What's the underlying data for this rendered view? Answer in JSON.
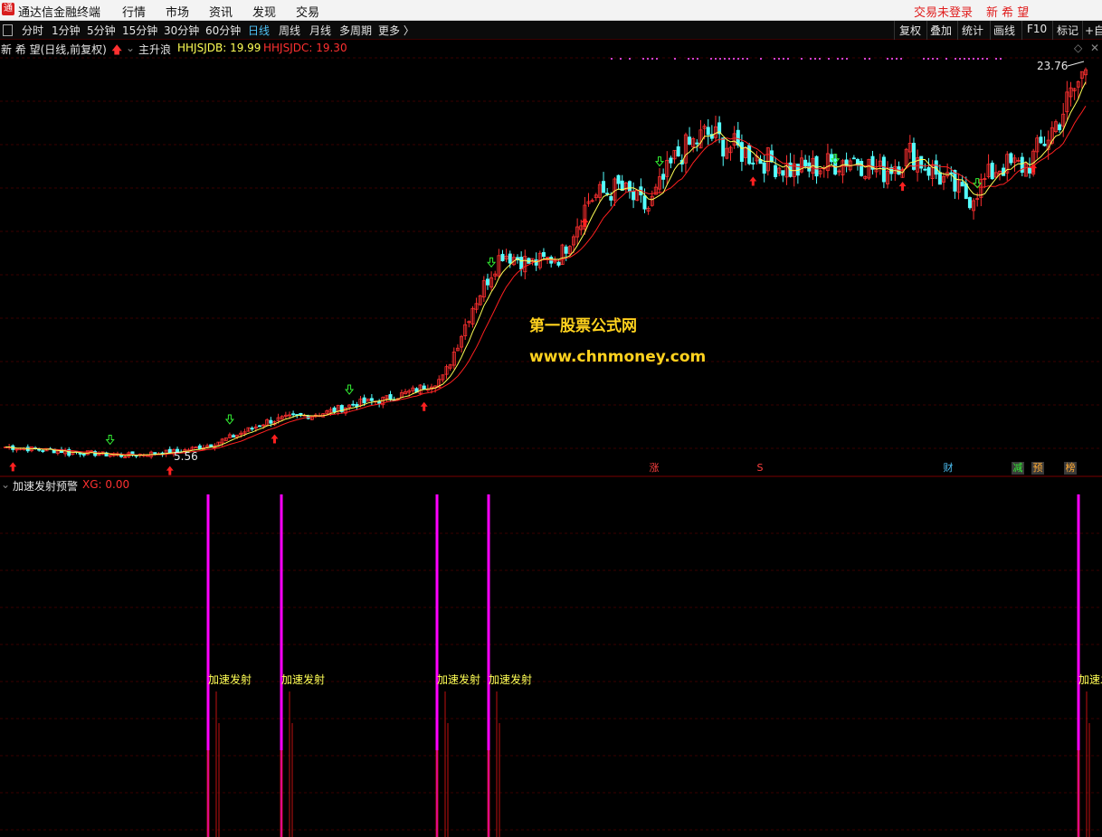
{
  "app": {
    "title": "通达信金融终端"
  },
  "menu": [
    "行情",
    "市场",
    "资讯",
    "发现",
    "交易"
  ],
  "status": {
    "login": "交易未登录",
    "stock_name": "新 希 望"
  },
  "periods": [
    "分时",
    "1分钟",
    "5分钟",
    "15分钟",
    "30分钟",
    "60分钟",
    "日线",
    "周线",
    "月线",
    "多周期",
    "更多 〉"
  ],
  "active_period": "日线",
  "right_tools": [
    "复权",
    "叠加",
    "统计",
    "画线",
    "F10",
    "标记",
    "+自"
  ],
  "main_chart": {
    "stock_label": "新 希 望(日线,前复权)",
    "indicator_name": "主升浪",
    "line1_label": "HHJSJDB: 19.99",
    "line2_label": "HHJSJDC: 19.30",
    "high_label": "23.76",
    "low_label": "5.56",
    "watermark_cn": "第一股票公式网",
    "watermark_url": "www.chnmoney.com",
    "event_markers": [
      "涨",
      "S",
      "财",
      "减",
      "预",
      "榜"
    ],
    "colors": {
      "up": "#ff3030",
      "down": "#54ffff",
      "ma_fast": "#ffff55",
      "ma_slow": "#ff2020",
      "buy_arrow": "#ff2020",
      "sell_arrow": "#33ee33"
    }
  },
  "sub_chart": {
    "indicator_name": "加速发射预警",
    "value_label": "XG: 0.00",
    "signal_label": "加速发射",
    "colors": {
      "signal": "#ff00ff",
      "label": "#ffff55"
    }
  },
  "chart_data": {
    "type": "candlestick",
    "price_high": 23.76,
    "price_low": 5.56,
    "close_series_approx": [
      6.0,
      5.9,
      5.8,
      5.7,
      5.6,
      5.7,
      5.8,
      6.1,
      6.6,
      7.2,
      7.4,
      7.6,
      8.0,
      8.2,
      8.6,
      9.2,
      12.5,
      15.0,
      14.5,
      14.8,
      17.5,
      18.0,
      17.0,
      19.5,
      20.5,
      19.8,
      19.3,
      18.8,
      19.0,
      19.4,
      18.7,
      19.6,
      18.5,
      17.5,
      19.0,
      19.0,
      21.0,
      23.5
    ],
    "signal_count": 5
  }
}
